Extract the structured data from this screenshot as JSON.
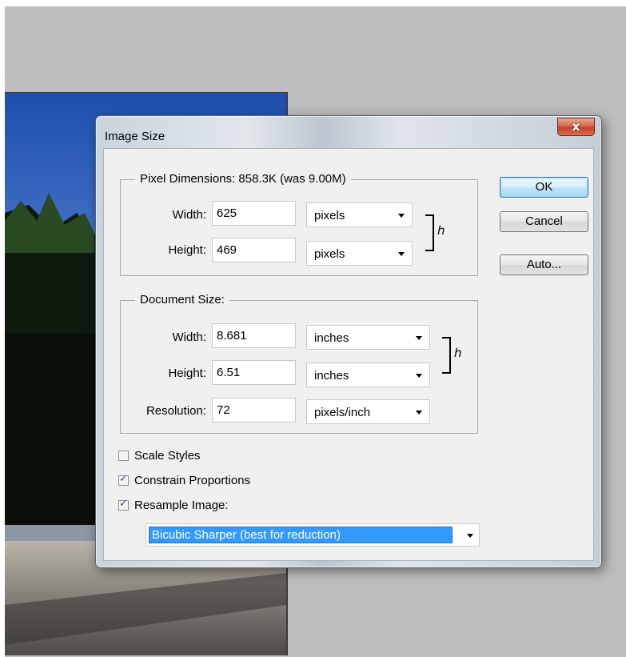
{
  "dialog": {
    "title": "Image Size",
    "close_symbol": "x",
    "buttons": {
      "ok": "OK",
      "cancel": "Cancel",
      "auto": "Auto..."
    }
  },
  "pixel_dimensions": {
    "legend": "Pixel Dimensions:",
    "size_info": "858.3K (was 9.00M)",
    "width_label": "Width:",
    "width_value": "625",
    "width_unit": "pixels",
    "height_label": "Height:",
    "height_value": "469",
    "height_unit": "pixels"
  },
  "document_size": {
    "legend": "Document Size:",
    "width_label": "Width:",
    "width_value": "8.681",
    "width_unit": "inches",
    "height_label": "Height:",
    "height_value": "6.51",
    "height_unit": "inches",
    "resolution_label": "Resolution:",
    "resolution_value": "72",
    "resolution_unit": "pixels/inch"
  },
  "options": {
    "scale_styles": {
      "label": "Scale Styles",
      "checked": false
    },
    "constrain_proportions": {
      "label": "Constrain Proportions",
      "checked": true
    },
    "resample_image": {
      "label": "Resample Image:",
      "checked": true
    },
    "resample_method": "Bicubic Sharper (best for reduction)"
  },
  "icons": {
    "link": "chain-link-icon",
    "check": "checkmark-icon",
    "dropdown": "chevron-down-icon"
  },
  "colors": {
    "selection": "#3399ff",
    "close": "#c2412a",
    "default_button": "#3c7fb1"
  }
}
